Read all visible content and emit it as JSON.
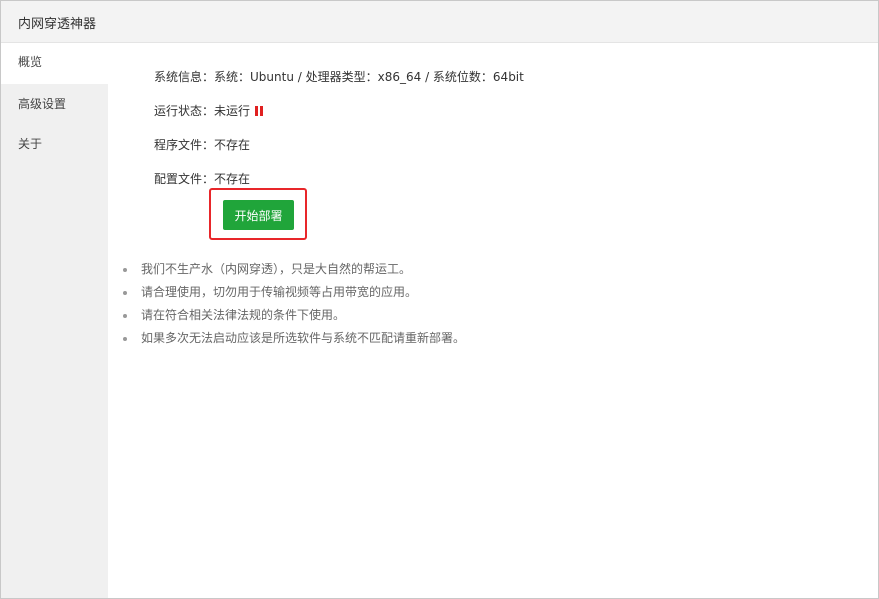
{
  "window": {
    "title": "内网穿透神器"
  },
  "sidebar": {
    "items": [
      {
        "label": "概览",
        "active": true
      },
      {
        "label": "高级设置",
        "active": false
      },
      {
        "label": "关于",
        "active": false
      }
    ]
  },
  "overview": {
    "system_info": {
      "label": "系统信息：",
      "value": "系统：Ubuntu / 处理器类型：x86_64 / 系统位数：64bit"
    },
    "run_status": {
      "label": "运行状态：",
      "value": "未运行",
      "icon": "pause-icon",
      "icon_color": "#e02020"
    },
    "program_file": {
      "label": "程序文件：",
      "value": "不存在"
    },
    "config_file": {
      "label": "配置文件：",
      "value": "不存在"
    },
    "deploy_button": {
      "label": "开始部署",
      "color": "#20a53a"
    },
    "highlight_color": "#e8262a"
  },
  "notes": [
    "我们不生产水（内网穿透），只是大自然的帮运工。",
    "请合理使用，切勿用于传输视频等占用带宽的应用。",
    "请在符合相关法律法规的条件下使用。",
    "如果多次无法启动应该是所选软件与系统不匹配请重新部署。"
  ]
}
